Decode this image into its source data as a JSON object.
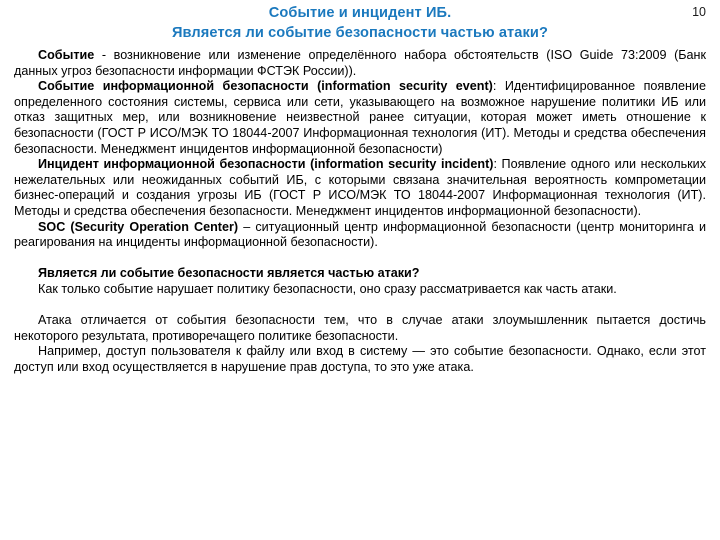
{
  "slide": {
    "page_number": "10",
    "title": {
      "line1": "Событие и инцидент ИБ.",
      "line2": "Является ли событие безопасности частью атаки?",
      "color": "#1b79be"
    },
    "paragraphs": [
      {
        "id": "p-event",
        "lead": "Событие",
        "rest": " - возникновение или изменение определённого набора обстоятельств (ISO Guide 73:2009 (Банк данных угроз безопасности информации ФСТЭК России))."
      },
      {
        "id": "p-security-event",
        "lead": "Событие информационной безопасности (information security event)",
        "rest": ": Идентифицированное появление определенного состояния системы, сервиса или сети, указывающего на возможное нарушение политики ИБ или отказ защитных мер, или возникновение неизвестной ранее ситуации, которая может иметь отношение к безопасности (ГОСТ Р ИСО/МЭК ТО 18044-2007 Информационная технология (ИТ). Методы и средства обеспечения безопасности. Менеджмент инцидентов информационной безопасности)"
      },
      {
        "id": "p-security-incident",
        "lead": "Инцидент информационной безопасности (information security incident)",
        "rest": ": Появление одного или нескольких нежелательных или неожиданных событий ИБ, с которыми связана значительная вероятность компрометации бизнес-операций и создания угрозы ИБ (ГОСТ Р ИСО/МЭК ТО 18044-2007 Информационная технология (ИТ). Методы и средства обеспечения безопасности. Менеджмент инцидентов информационной безопасности)."
      },
      {
        "id": "p-soc",
        "lead": "SOC (Security Operation Center)",
        "rest": " – ситуационный центр информационной безопасности (центр мониторинга и реагирования на инциденты информационной безопасности)."
      }
    ],
    "question_section": {
      "heading": "Является ли событие безопасности является частью атаки?",
      "answer": "Как только событие нарушает политику безопасности, оно сразу рассматривается как часть атаки."
    },
    "closing_paragraphs": [
      "Атака отличается от события безопасности тем, что в случае атаки злоумышленник пытается достичь некоторого результата, противоречащего политике безопасности.",
      "Например, доступ пользователя к файлу или вход в систему — это событие безопасности. Однако, если этот доступ или вход осуществляется в нарушение прав доступа, то это уже атака."
    ]
  }
}
